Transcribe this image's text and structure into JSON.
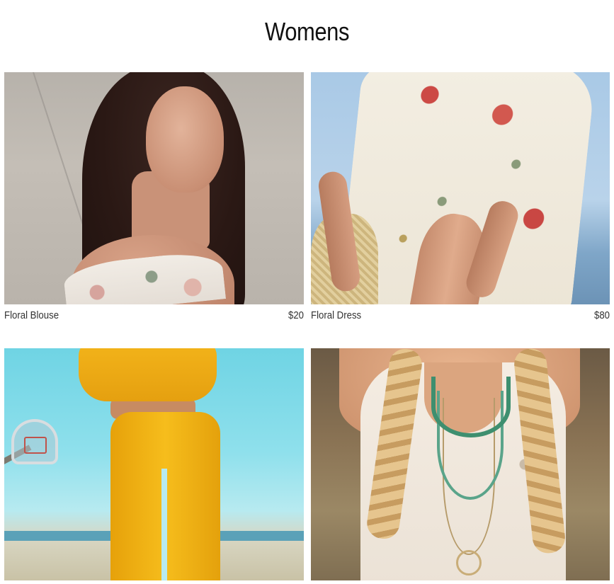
{
  "page": {
    "title": "Womens"
  },
  "products": [
    {
      "name": "Floral Blouse",
      "price": "$20",
      "image": "woman-off-shoulder-floral-blouse-photo"
    },
    {
      "name": "Floral Dress",
      "price": "$80",
      "image": "woman-floral-wrap-dress-with-straw-bag-photo"
    },
    {
      "name": "",
      "price": "",
      "image": "woman-yellow-sweatsuit-basketball-court-photo"
    },
    {
      "name": "",
      "price": "",
      "image": "woman-boho-top-with-necklaces-photo"
    }
  ]
}
